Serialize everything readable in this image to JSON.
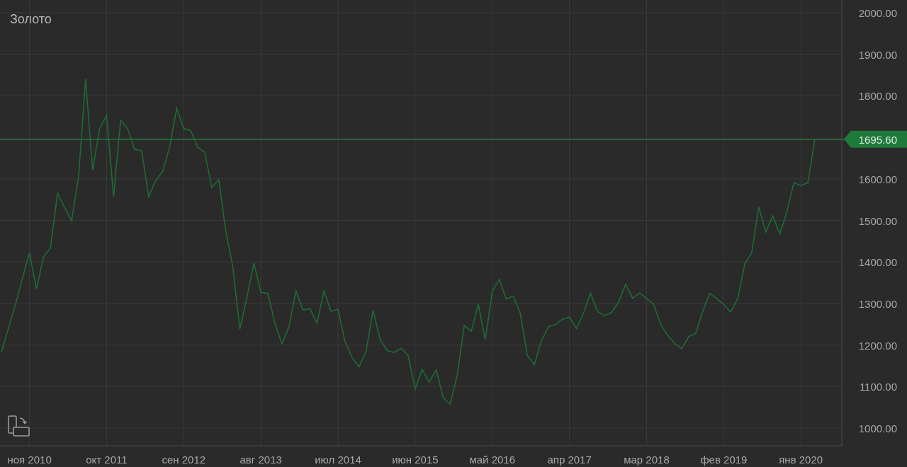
{
  "chart_data": {
    "type": "line",
    "title": "Золото",
    "categories": [
      null,
      null,
      null,
      null,
      "ноя 2010",
      null,
      null,
      null,
      null,
      null,
      null,
      null,
      null,
      null,
      null,
      "окт 2011",
      null,
      null,
      null,
      null,
      null,
      null,
      null,
      null,
      null,
      null,
      "сен 2012",
      null,
      null,
      null,
      null,
      null,
      null,
      null,
      null,
      null,
      null,
      "авг 2013",
      null,
      null,
      null,
      null,
      null,
      null,
      null,
      null,
      null,
      null,
      "июл 2014",
      null,
      null,
      null,
      null,
      null,
      null,
      null,
      null,
      null,
      null,
      "июн 2015",
      null,
      null,
      null,
      null,
      null,
      null,
      null,
      null,
      null,
      null,
      "май 2016",
      null,
      null,
      null,
      null,
      null,
      null,
      null,
      null,
      null,
      null,
      "апр 2017",
      null,
      null,
      null,
      null,
      null,
      null,
      null,
      null,
      null,
      null,
      "мар 2018",
      null,
      null,
      null,
      null,
      null,
      null,
      null,
      null,
      null,
      null,
      "фев 2019",
      null,
      null,
      null,
      null,
      null,
      null,
      null,
      null,
      null,
      null,
      "янв 2020",
      null,
      null
    ],
    "series": [
      {
        "color": "#1e6b34",
        "values": [
          1182,
          1240,
          1298,
          1361,
          1422,
          1335,
          1412,
          1434,
          1566,
          1531,
          1499,
          1605,
          1840,
          1622,
          1721,
          1753,
          1557,
          1741,
          1721,
          1671,
          1668,
          1557,
          1596,
          1618,
          1678,
          1770,
          1721,
          1716,
          1676,
          1664,
          1579,
          1598,
          1474,
          1388,
          1238,
          1315,
          1397,
          1327,
          1324,
          1252,
          1203,
          1244,
          1330,
          1284,
          1288,
          1252,
          1330,
          1281,
          1286,
          1208,
          1170,
          1148,
          1184,
          1284,
          1213,
          1187,
          1182,
          1192,
          1175,
          1094,
          1141,
          1111,
          1140,
          1073,
          1058,
          1128,
          1247,
          1233,
          1298,
          1213,
          1330,
          1358,
          1310,
          1318,
          1276,
          1175,
          1152,
          1210,
          1244,
          1249,
          1262,
          1267,
          1240,
          1276,
          1325,
          1281,
          1271,
          1278,
          1303,
          1346,
          1313,
          1325,
          1312,
          1298,
          1250,
          1223,
          1204,
          1191,
          1220,
          1228,
          1281,
          1324,
          1312,
          1298,
          1279,
          1312,
          1395,
          1422,
          1532,
          1472,
          1511,
          1468,
          1520,
          1591,
          1584,
          1591,
          1695
        ]
      }
    ],
    "ylim": [
      957.4,
      2030.7
    ],
    "yticks": [
      {
        "value": 1000,
        "label": "1000.00"
      },
      {
        "value": 1100,
        "label": "1100.00"
      },
      {
        "value": 1200,
        "label": "1200.00"
      },
      {
        "value": 1300,
        "label": "1300.00"
      },
      {
        "value": 1400,
        "label": "1400.00"
      },
      {
        "value": 1500,
        "label": "1500.00"
      },
      {
        "value": 1600,
        "label": "1600.00"
      },
      {
        "value": 1800,
        "label": "1800.00"
      },
      {
        "value": 1900,
        "label": "1900.00"
      },
      {
        "value": 2000,
        "label": "2000.00"
      }
    ],
    "grid": true,
    "ref_lines": [
      {
        "axis": "y",
        "value": 1695.6,
        "label": "1695.60"
      }
    ]
  }
}
